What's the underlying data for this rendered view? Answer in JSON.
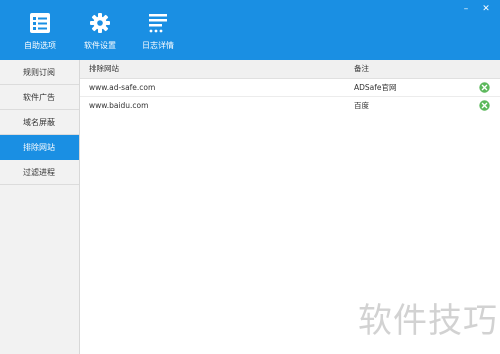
{
  "window_controls": {
    "minimize": "–",
    "close": "✕"
  },
  "toolbar": {
    "items": [
      {
        "label": "自助选项",
        "icon": "checklist-icon"
      },
      {
        "label": "软件设置",
        "icon": "gear-icon"
      },
      {
        "label": "日志详情",
        "icon": "log-list-icon"
      }
    ]
  },
  "sidebar": {
    "items": [
      {
        "label": "规则订阅",
        "active": false
      },
      {
        "label": "软件广告",
        "active": false
      },
      {
        "label": "域名屏蔽",
        "active": false
      },
      {
        "label": "排除网站",
        "active": true
      },
      {
        "label": "过滤进程",
        "active": false
      }
    ]
  },
  "table": {
    "headers": {
      "site": "排除网站",
      "note": "备注"
    },
    "rows": [
      {
        "site": "www.ad-safe.com",
        "note": "ADSafe官网"
      },
      {
        "site": "www.baidu.com",
        "note": "百度"
      }
    ]
  },
  "watermark": {
    "text": "软件技巧"
  },
  "colors": {
    "accent": "#1a8fe3",
    "delete_icon": "#5cb85c",
    "sidebar_bg": "#f2f2f2"
  }
}
